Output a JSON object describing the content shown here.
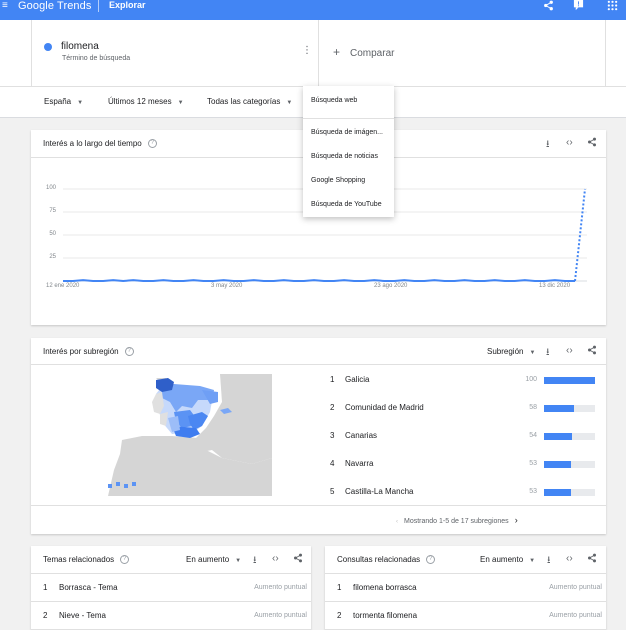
{
  "app": {
    "logo": "Google Trends",
    "section": "Explorar"
  },
  "term": {
    "name": "filomena",
    "type": "Término de búsqueda"
  },
  "compare": {
    "label": "Comparar"
  },
  "filters": {
    "country": "España",
    "period": "Últimos 12 meses",
    "category": "Todas las categorías"
  },
  "dropdown": {
    "items": [
      "Búsqueda web",
      "Búsqueda de imágen...",
      "Búsqueda de noticias",
      "Google Shopping",
      "Búsqueda de YouTube"
    ]
  },
  "interest_time": {
    "title": "Interés a lo largo del tiempo"
  },
  "chart_data": {
    "type": "line",
    "title": "Interés a lo largo del tiempo",
    "x_tick_labels": [
      "12 ene 2020",
      "3 may 2020",
      "23 ago 2020",
      "13 dic 2020"
    ],
    "y_ticks": [
      25,
      50,
      75,
      100
    ],
    "ylim": [
      0,
      100
    ],
    "series": [
      {
        "values": [
          0,
          0,
          1,
          0,
          0,
          1,
          0,
          1,
          0,
          0,
          1,
          0,
          0,
          1,
          0,
          0,
          1,
          0,
          0,
          1,
          0,
          0,
          1,
          0,
          0,
          1,
          0,
          0,
          1,
          0,
          0,
          1,
          0,
          0,
          1,
          0,
          0,
          1,
          0,
          0,
          1,
          0,
          0,
          1,
          0,
          0,
          1,
          0,
          0,
          1,
          0,
          0,
          100
        ]
      }
    ],
    "color": "#4285f4",
    "partial_last_point": true,
    "grid": true
  },
  "region": {
    "title": "Interés por subregión",
    "selector": "Subregión",
    "items": [
      {
        "rank": "1",
        "name": "Galicia",
        "value": 100
      },
      {
        "rank": "2",
        "name": "Comunidad de Madrid",
        "value": 58
      },
      {
        "rank": "3",
        "name": "Canarias",
        "value": 54
      },
      {
        "rank": "4",
        "name": "Navarra",
        "value": 53
      },
      {
        "rank": "5",
        "name": "Castilla-La Mancha",
        "value": 53
      }
    ],
    "pager": "Mostrando 1-5 de 17 subregiones"
  },
  "topics": {
    "title": "Temas relacionados",
    "selector": "En aumento",
    "items": [
      {
        "rank": "1",
        "name": "Borrasca - Tema",
        "value": "Aumento puntual"
      },
      {
        "rank": "2",
        "name": "Nieve - Tema",
        "value": "Aumento puntual"
      }
    ]
  },
  "queries": {
    "title": "Consultas relacionadas",
    "selector": "En aumento",
    "items": [
      {
        "rank": "1",
        "name": "filomena borrasca",
        "value": "Aumento puntual"
      },
      {
        "rank": "2",
        "name": "tormenta filomena",
        "value": "Aumento puntual"
      }
    ]
  }
}
